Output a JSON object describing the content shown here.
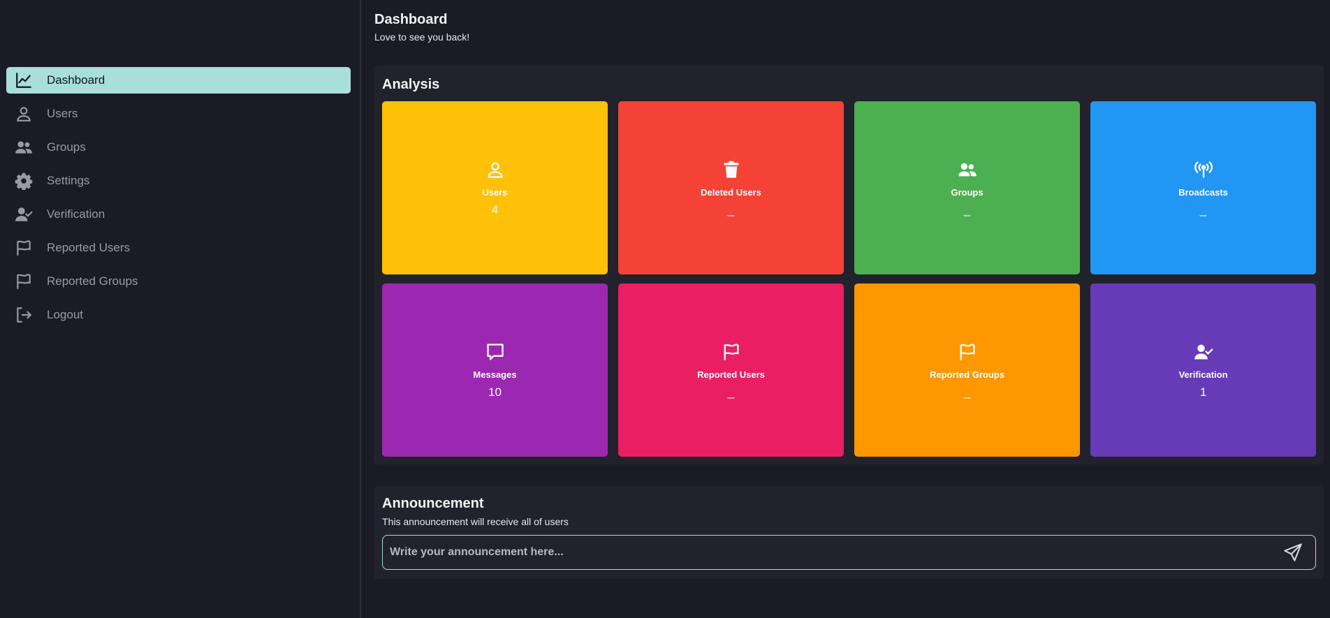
{
  "sidebar": {
    "items": [
      {
        "label": "Dashboard",
        "icon": "chart-line-icon"
      },
      {
        "label": "Users",
        "icon": "user-icon"
      },
      {
        "label": "Groups",
        "icon": "users-icon"
      },
      {
        "label": "Settings",
        "icon": "gear-icon"
      },
      {
        "label": "Verification",
        "icon": "user-check-icon"
      },
      {
        "label": "Reported Users",
        "icon": "flag-icon"
      },
      {
        "label": "Reported Groups",
        "icon": "flag-icon"
      },
      {
        "label": "Logout",
        "icon": "logout-icon"
      }
    ],
    "active_color": "#a9dfd9"
  },
  "header": {
    "title": "Dashboard",
    "subtitle": "Love to see you back!"
  },
  "analysis": {
    "title": "Analysis",
    "cards": [
      {
        "label": "Users",
        "value": "4",
        "color": "#ffc107",
        "icon": "user-icon"
      },
      {
        "label": "Deleted Users",
        "value": "_",
        "color": "#f44336",
        "icon": "trash-icon"
      },
      {
        "label": "Groups",
        "value": "_",
        "color": "#4caf50",
        "icon": "users-icon"
      },
      {
        "label": "Broadcasts",
        "value": "_",
        "color": "#2196f3",
        "icon": "broadcast-icon"
      },
      {
        "label": "Messages",
        "value": "10",
        "color": "#9c27b0",
        "icon": "message-icon"
      },
      {
        "label": "Reported Users",
        "value": "_",
        "color": "#e91e63",
        "icon": "flag-icon"
      },
      {
        "label": "Reported Groups",
        "value": "_",
        "color": "#ff9800",
        "icon": "flag-icon"
      },
      {
        "label": "Verification",
        "value": "1",
        "color": "#673ab7",
        "icon": "user-check-icon"
      }
    ]
  },
  "announcement": {
    "title": "Announcement",
    "subtitle": "This announcement will receive all of users",
    "input_value": "",
    "placeholder": "Write your announcement here...",
    "send_icon": "send-icon"
  }
}
